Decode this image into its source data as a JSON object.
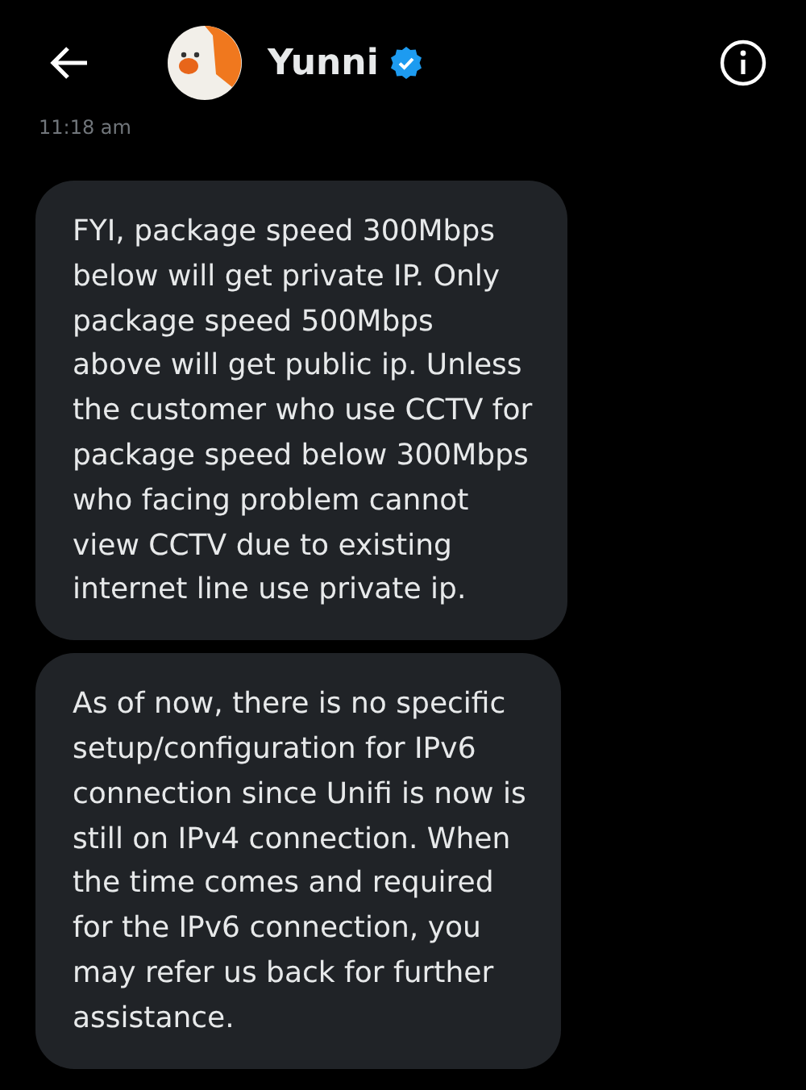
{
  "header": {
    "title": "Yunni",
    "verified": true
  },
  "timestamp": "11:18 am",
  "messages": [
    {
      "text": "FYI, package speed 300Mbps\nbelow will get private IP. Only\npackage speed 500Mbps\nabove will get public ip. Unless\nthe customer who use CCTV for\npackage speed below 300Mbps\nwho facing problem cannot\nview CCTV due to existing\ninternet line use private ip."
    },
    {
      "text": "As of now, there is no specific\nsetup/configuration for IPv6\nconnection since Unifi is now is\nstill on IPv4 connection. When\nthe time comes and required\nfor the IPv6 connection, you\nmay refer us back for further\nassistance."
    }
  ]
}
